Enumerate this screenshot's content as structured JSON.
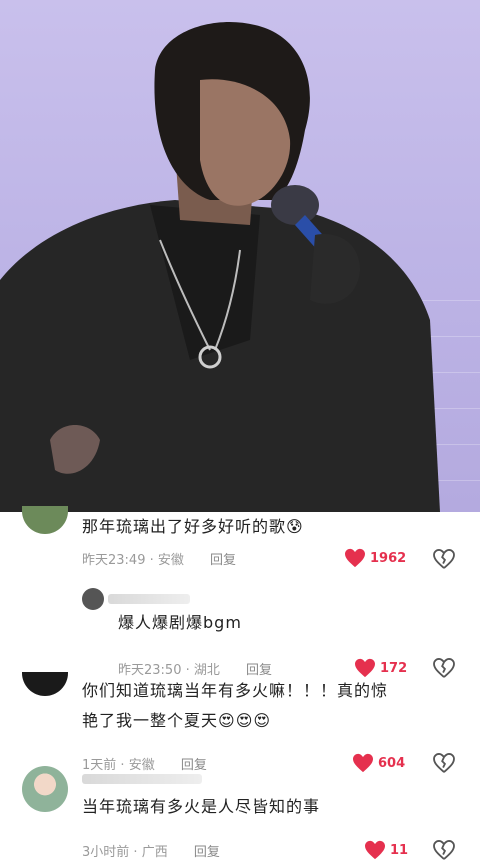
{
  "comments": [
    {
      "text": "那年琉璃出了好多好听的歌",
      "emoji": "😰",
      "time": "昨天23:49",
      "sep": "·",
      "location": "安徽",
      "reply_label": "回复",
      "likes": "1962"
    },
    {
      "text": "爆人爆剧爆bgm",
      "time": "昨天23:50",
      "sep": "·",
      "location": "湖北",
      "reply_label": "回复",
      "likes": "172"
    },
    {
      "line1": "你们知道琉璃当年有多火嘛！！！真的惊",
      "line2": "艳了我一整个夏天",
      "emoji": "😍😍😍",
      "time": "1天前",
      "sep": "·",
      "location": "安徽",
      "reply_label": "回复",
      "likes": "604"
    },
    {
      "text": "当年琉璃有多火是人尽皆知的事",
      "time": "3小时前",
      "sep": "·",
      "location": "广西",
      "reply_label": "回复",
      "likes": "11"
    }
  ],
  "colors": {
    "like": "#e5304e",
    "meta": "#9a9a9a",
    "stage": "#c4bbea"
  },
  "icons": {
    "like": "heart-icon",
    "dislike": "broken-heart-icon"
  }
}
